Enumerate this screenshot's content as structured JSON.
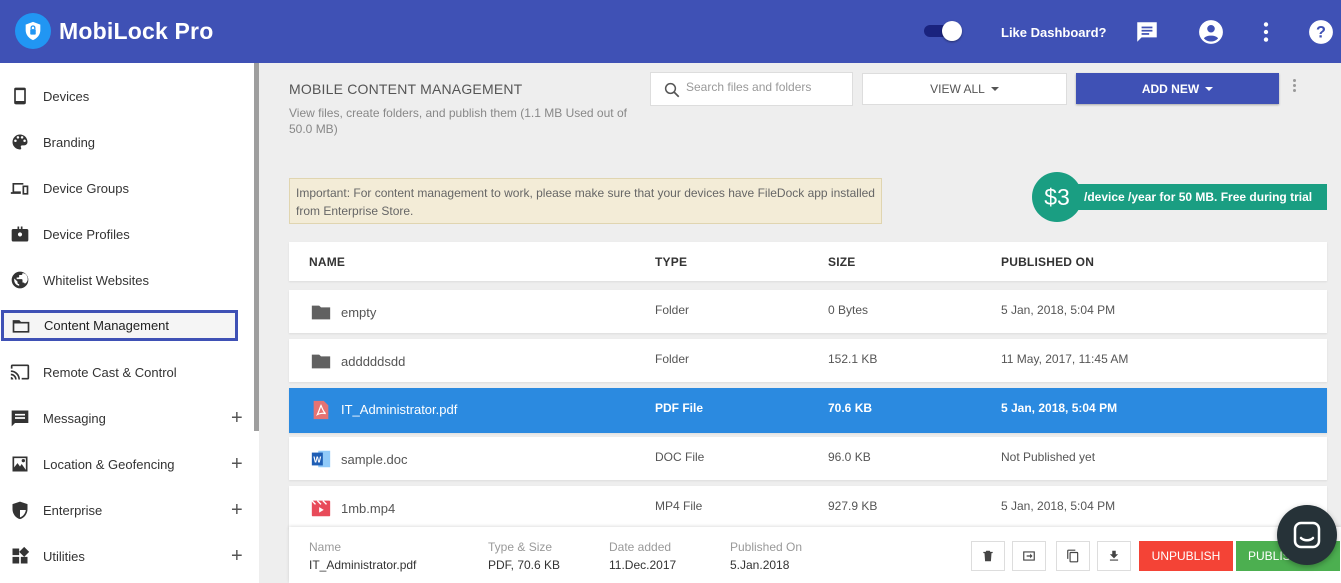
{
  "app": {
    "title": "MobiLock Pro",
    "like_dashboard": "Like Dashboard?"
  },
  "header_icons": [
    "chat-icon",
    "account-icon",
    "more-vert-icon",
    "help-icon"
  ],
  "sidebar": {
    "items": [
      {
        "label": "Devices",
        "icon": "phone-icon"
      },
      {
        "label": "Branding",
        "icon": "palette-icon"
      },
      {
        "label": "Device Groups",
        "icon": "devices-icon"
      },
      {
        "label": "Device Profiles",
        "icon": "profile-icon"
      },
      {
        "label": "Whitelist Websites",
        "icon": "globe-icon"
      },
      {
        "label": "Content Management",
        "icon": "folder-icon",
        "active": true
      },
      {
        "label": "Remote Cast & Control",
        "icon": "cast-icon"
      },
      {
        "label": "Messaging",
        "icon": "message-icon",
        "expandable": true
      },
      {
        "label": "Location & Geofencing",
        "icon": "map-icon",
        "expandable": true
      },
      {
        "label": "Enterprise",
        "icon": "shield-icon",
        "expandable": true
      },
      {
        "label": "Utilities",
        "icon": "widgets-icon",
        "expandable": true
      }
    ],
    "plus": "+"
  },
  "main": {
    "title": "MOBILE CONTENT MANAGEMENT",
    "subtitle": "View files, create folders, and publish them (1.1 MB Used out of 50.0 MB)",
    "search_placeholder": "Search files and folders",
    "view_all": "VIEW ALL",
    "add_new": "ADD NEW",
    "notice": "Important: For content management to work, please make sure that your devices have FileDock app installed from Enterprise Store.",
    "price": "$3",
    "price_text": "/device /year for 50 MB. Free during trial"
  },
  "table": {
    "headers": {
      "name": "NAME",
      "type": "TYPE",
      "size": "SIZE",
      "published": "PUBLISHED ON"
    },
    "rows": [
      {
        "name": "empty",
        "type": "Folder",
        "size": "0 Bytes",
        "published": "5 Jan, 2018, 5:04 PM",
        "icon": "folder-icon"
      },
      {
        "name": "adddddsdd",
        "type": "Folder",
        "size": "152.1 KB",
        "published": "11 May, 2017, 11:45 AM",
        "icon": "folder-icon"
      },
      {
        "name": "IT_Administrator.pdf",
        "type": "PDF File",
        "size": "70.6 KB",
        "published": "5 Jan, 2018, 5:04 PM",
        "icon": "pdf-icon",
        "selected": true
      },
      {
        "name": "sample.doc",
        "type": "DOC File",
        "size": "96.0 KB",
        "published": "Not Published yet",
        "icon": "word-icon"
      },
      {
        "name": "1mb.mp4",
        "type": "MP4 File",
        "size": "927.9 KB",
        "published": "5 Jan, 2018, 5:04 PM",
        "icon": "video-icon"
      }
    ]
  },
  "detail": {
    "name_label": "Name",
    "name_value": "IT_Administrator.pdf",
    "type_label": "Type & Size",
    "type_value": "PDF, 70.6 KB",
    "date_label": "Date added",
    "date_value": "11.Dec.2017",
    "pub_label": "Published On",
    "pub_value": "5.Jan.2018",
    "unpublish": "UNPUBLISH",
    "publish": "PUBLISH"
  },
  "colors": {
    "primary": "#3f51b5",
    "selected_row": "#2b8ae0",
    "teal": "#1a9e82",
    "danger": "#f44336",
    "success": "#4caf50"
  }
}
